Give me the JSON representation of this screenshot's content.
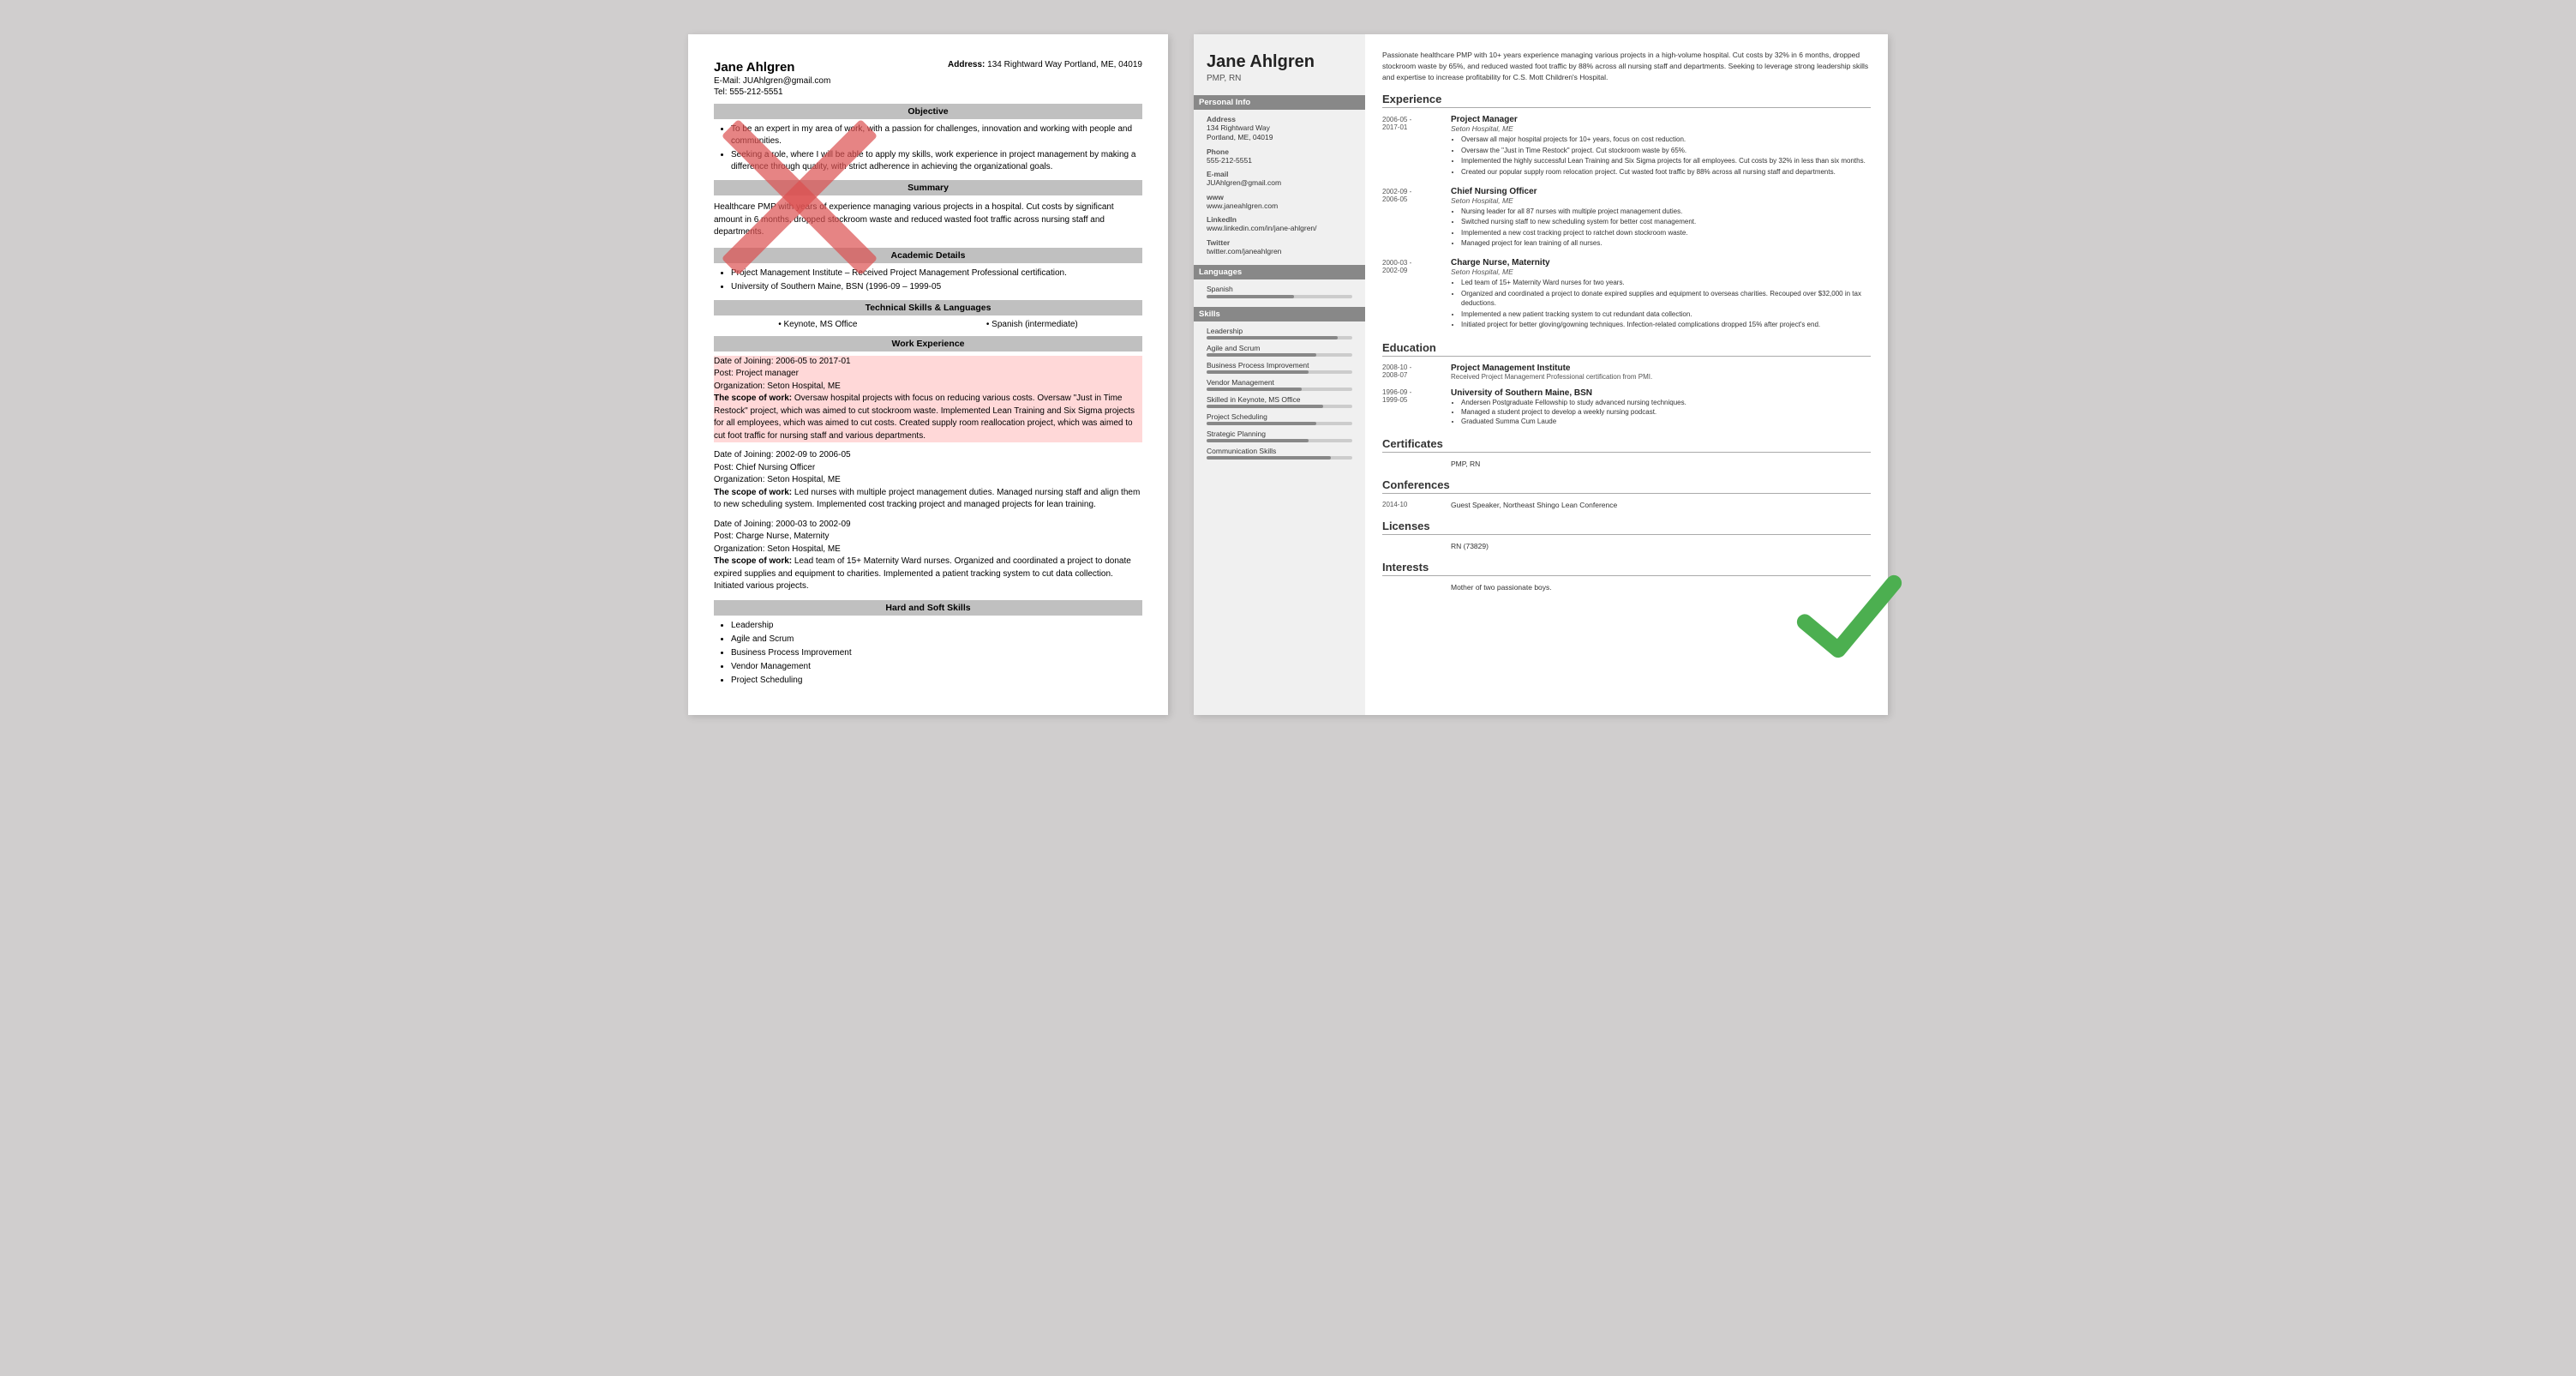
{
  "left_resume": {
    "name": "Jane Ahlgren",
    "email_label": "E-Mail:",
    "email": "JUAhlgren@gmail.com",
    "address_label": "Address:",
    "address": "134 Rightward Way Portland, ME, 04019",
    "tel_label": "Tel:",
    "tel": "555-212-5551",
    "sections": {
      "objective": {
        "title": "Objective",
        "bullets": [
          "To be an expert in my area of work, with a passion for challenges, innovation and working with people and communities.",
          "Seeking a role, where I will be able to apply my skills, work experience in project management by making a difference through quality, with strict adherence in achieving the organizational goals."
        ]
      },
      "summary": {
        "title": "Summary",
        "text": "Healthcare PMP with years of experience managing various projects in a hospital. Cut costs by significant amount in 6 months, dropped stockroom waste and reduced wasted foot traffic across nursing staff and departments."
      },
      "academic": {
        "title": "Academic Details",
        "bullets": [
          "Project Management Institute – Received Project Management Professional certification.",
          "University of Southern Maine, BSN (1996-09 – 1999-05"
        ]
      },
      "technical": {
        "title": "Technical Skills & Languages",
        "skills": [
          "Keynote, MS Office",
          "Spanish (intermediate)"
        ]
      },
      "work": {
        "title": "Work Experience",
        "entries": [
          {
            "date_of_joining": "Date of Joining: 2006-05 to 2017-01",
            "post": "Post: Project manager",
            "org": "Organization: Seton Hospital, ME",
            "scope_label": "The scope of work:",
            "scope": " Oversaw hospital projects with focus on reducing various costs. Oversaw \"Just in Time Restock\" project, which was aimed to cut stockroom waste. Implemented Lean Training and Six Sigma projects for all employees, which was aimed to cut costs. Created supply room reallocation project, which was aimed to cut foot traffic for nursing staff and various departments."
          },
          {
            "date_of_joining": "Date of Joining: 2002-09 to 2006-05",
            "post": "Post: Chief Nursing Officer",
            "org": "Organization: Seton Hospital, ME",
            "scope_label": "The scope of work:",
            "scope": " Led nurses with multiple project management duties. Managed nursing staff and align them to new scheduling system. Implemented cost tracking project and managed projects for lean training."
          },
          {
            "date_of_joining": "Date of Joining: 2000-03 to 2002-09",
            "post": "Post: Charge Nurse, Maternity",
            "org": "Organization: Seton Hospital, ME",
            "scope_label": "The scope of work:",
            "scope": " Lead team of 15+ Maternity Ward nurses. Organized and coordinated a project to donate expired supplies and equipment to charities. Implemented a patient tracking system to cut data collection. Initiated various projects."
          }
        ]
      },
      "hard_soft": {
        "title": "Hard and Soft Skills",
        "bullets": [
          "Leadership",
          "Agile and Scrum",
          "Business Process Improvement",
          "Vendor Management",
          "Project Scheduling"
        ]
      }
    }
  },
  "right_resume": {
    "name": "Jane Ahlgren",
    "title": "PMP, RN",
    "summary": "Passionate healthcare PMP with 10+ years experience managing various projects in a high-volume hospital. Cut costs by 32% in 6 months, dropped stockroom waste by 65%, and reduced wasted foot traffic by 88% across all nursing staff and departments. Seeking to leverage strong leadership skills and expertise to increase profitability for C.S. Mott Children's Hospital.",
    "sidebar": {
      "personal_info_title": "Personal Info",
      "address_label": "Address",
      "address": "134 Rightward Way\nPortland, ME, 04019",
      "phone_label": "Phone",
      "phone": "555-212-5551",
      "email_label": "E-mail",
      "email": "JUAhlgren@gmail.com",
      "www_label": "www",
      "www": "www.janeahlgren.com",
      "linkedin_label": "LinkedIn",
      "linkedin": "www.linkedin.com/in/jane-ahlgren/",
      "twitter_label": "Twitter",
      "twitter": "twitter.com/janeahlgren",
      "languages_title": "Languages",
      "languages": [
        {
          "name": "Spanish",
          "level": 60
        }
      ],
      "skills_title": "Skills",
      "skills": [
        {
          "name": "Leadership",
          "level": 90
        },
        {
          "name": "Agile and Scrum",
          "level": 75
        },
        {
          "name": "Business Process Improvement",
          "level": 70
        },
        {
          "name": "Vendor Management",
          "level": 65
        },
        {
          "name": "Skilled in Keynote, MS Office",
          "level": 80
        },
        {
          "name": "Project Scheduling",
          "level": 75
        },
        {
          "name": "Strategic Planning",
          "level": 70
        },
        {
          "name": "Communication Skills",
          "level": 85
        }
      ]
    },
    "experience": {
      "title": "Experience",
      "entries": [
        {
          "date": "2006-05 -\n2017-01",
          "job_title": "Project Manager",
          "org": "Seton Hospital, ME",
          "bullets": [
            "Oversaw all major hospital projects for 10+ years, focus on cost reduction.",
            "Oversaw the \"Just in Time Restock\" project. Cut stockroom waste by 65%.",
            "Implemented the highly successful Lean Training and Six Sigma projects for all employees. Cut costs by 32% in less than six months.",
            "Created our popular supply room relocation project. Cut wasted foot traffic by 88% across all nursing staff and departments."
          ]
        },
        {
          "date": "2002-09 -\n2006-05",
          "job_title": "Chief Nursing Officer",
          "org": "Seton Hospital, ME",
          "bullets": [
            "Nursing leader for all 87 nurses with multiple project management duties.",
            "Switched nursing staff to new scheduling system for better cost management.",
            "Implemented a new cost tracking project to ratchet down stockroom waste.",
            "Managed project for lean training of all nurses."
          ]
        },
        {
          "date": "2000-03 -\n2002-09",
          "job_title": "Charge Nurse, Maternity",
          "org": "Seton Hospital, ME",
          "bullets": [
            "Led team of 15+ Maternity Ward nurses for two years.",
            "Organized and coordinated a project to donate expired supplies and equipment to overseas charities. Recouped over $32,000 in tax deductions.",
            "Implemented a new patient tracking system to cut redundant data collection.",
            "Initiated project for better gloving/gowning techniques. Infection-related complications dropped 15% after project's end."
          ]
        }
      ]
    },
    "education": {
      "title": "Education",
      "entries": [
        {
          "date": "2008-10 -\n2008-07",
          "school": "Project Management Institute",
          "detail": "Received Project Management Professional certification from PMI."
        },
        {
          "date": "1996-09 -\n1999-05",
          "school": "University of Southern Maine, BSN",
          "bullets": [
            "Andersen Postgraduate Fellowship to study advanced nursing techniques.",
            "Managed a student project to develop a weekly nursing podcast.",
            "Graduated Summa Cum Laude"
          ]
        }
      ]
    },
    "certificates": {
      "title": "Certificates",
      "items": [
        "PMP, RN"
      ]
    },
    "conferences": {
      "title": "Conferences",
      "entries": [
        {
          "date": "2014-10",
          "text": "Guest Speaker, Northeast Shingo Lean Conference"
        }
      ]
    },
    "licenses": {
      "title": "Licenses",
      "items": [
        "RN (73829)"
      ]
    },
    "interests": {
      "title": "Interests",
      "items": [
        "Mother of two passionate boys."
      ]
    }
  }
}
